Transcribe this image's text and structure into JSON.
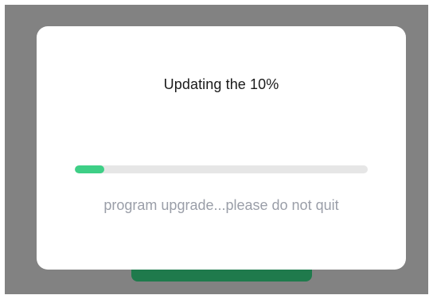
{
  "dialog": {
    "title": "Updating the 10%",
    "message": "program upgrade...please do not quit"
  },
  "progress": {
    "value": 0.1
  },
  "colors": {
    "overlay": "#828282",
    "progress_fill": "#3ecf86",
    "progress_track": "#e6e6e6",
    "underlay_button": "#1f7a4c",
    "message_text": "#9a9ea8"
  }
}
